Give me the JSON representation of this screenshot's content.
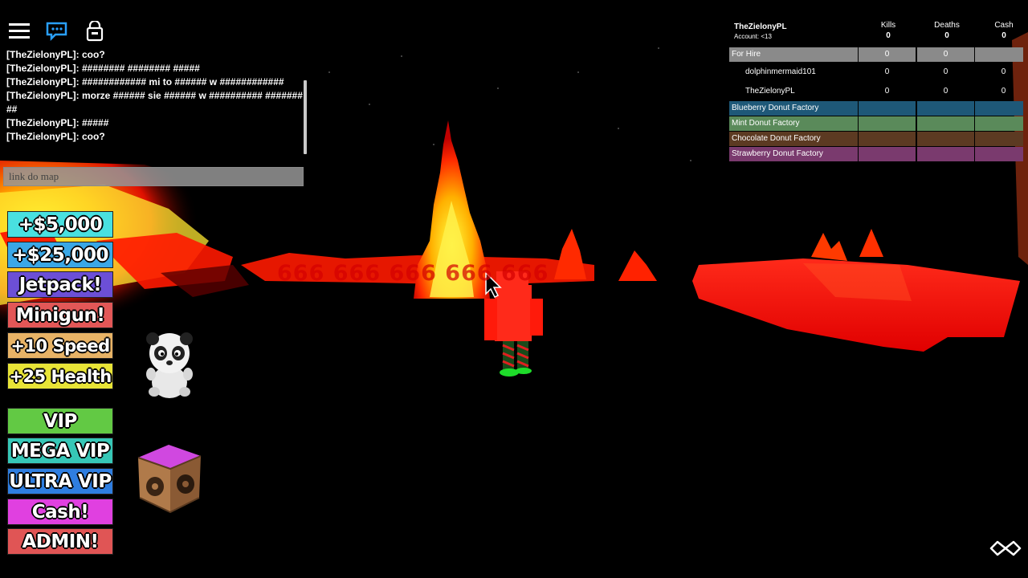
{
  "topbar": {
    "menu_icon": "hamburger-menu-icon",
    "chat_icon": "chat-bubble-icon",
    "backpack_icon": "backpack-icon"
  },
  "chat": {
    "messages": [
      "[TheZielonyPL]: coo?",
      "[TheZielonyPL]: ######## ######## #####",
      "[TheZielonyPL]: ############ mi to ###### w ############",
      "[TheZielonyPL]: morze ###### sie ###### w ########## #########",
      "[TheZielonyPL]: #####",
      "[TheZielonyPL]: coo?"
    ],
    "input_value": "link do map"
  },
  "shop": {
    "buttons": [
      {
        "label": "+$5,000",
        "color": "#49e0e0"
      },
      {
        "label": "+$25,000",
        "color": "#3aa7e6"
      },
      {
        "label": "Jetpack!",
        "color": "#6c4fd6"
      },
      {
        "label": "Minigun!",
        "color": "#e35757"
      },
      {
        "label": "+10 Speed",
        "color": "#e8b366"
      },
      {
        "label": "+25 Health",
        "color": "#e8e437"
      },
      {
        "label": "VIP",
        "color": "#62c944"
      },
      {
        "label": "MEGA VIP",
        "color": "#36c7b7"
      },
      {
        "label": "ULTRA VIP",
        "color": "#2f7ee0"
      },
      {
        "label": "Cash!",
        "color": "#e040e0"
      },
      {
        "label": "ADMIN!",
        "color": "#e05555"
      }
    ],
    "panda_icon": "panda-pet-icon",
    "crate_icon": "donut-crate-icon"
  },
  "leaderboard": {
    "player": "TheZielonyPL",
    "account": "Account: <13",
    "stats": [
      {
        "name": "Kills",
        "value": "0"
      },
      {
        "name": "Deaths",
        "value": "0"
      },
      {
        "name": "Cash",
        "value": "0"
      }
    ],
    "teams": [
      {
        "name": "For Hire",
        "color": "#8a8a8a",
        "values": [
          "0",
          "0",
          ""
        ]
      },
      {
        "name": "dolphinmermaid101",
        "color": "",
        "values": [
          "0",
          "0",
          "0"
        ],
        "player": true
      },
      {
        "name": "TheZielonyPL",
        "color": "",
        "values": [
          "0",
          "0",
          "0"
        ],
        "player": true
      },
      {
        "name": "Blueberry Donut Factory",
        "color": "#1e5878",
        "values": [
          "",
          "",
          ""
        ]
      },
      {
        "name": "Mint Donut Factory",
        "color": "#5a8a5a",
        "values": [
          "",
          "",
          ""
        ]
      },
      {
        "name": "Chocolate Donut Factory",
        "color": "#5c3a22",
        "values": [
          "",
          "",
          ""
        ]
      },
      {
        "name": "Strawberry Donut Factory",
        "color": "#7a3a6e",
        "values": [
          "",
          "",
          ""
        ]
      }
    ]
  },
  "overlay_text": "666 666 666 666 666",
  "corner_logo": "infinity-logo-icon"
}
